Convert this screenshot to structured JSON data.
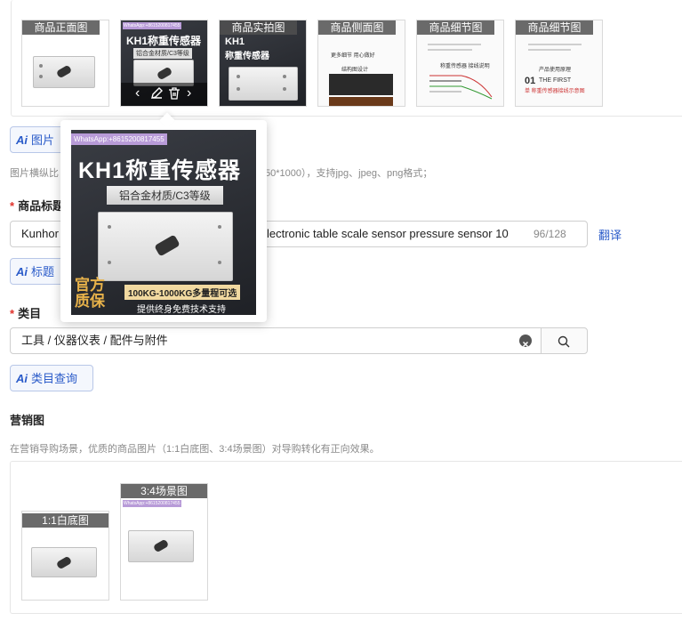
{
  "product_images": {
    "thumbnails": [
      {
        "label": "商品正面图"
      },
      {
        "label": "",
        "watermark": "WhatsApp:+8615200817455",
        "title": "KH1称重传感器",
        "subtitle": "铝合金材质/C3等级"
      },
      {
        "label": "商品实拍图",
        "title": "KH1",
        "subtitle": "称重传感器"
      },
      {
        "label": "商品侧面图",
        "text1": "更多细节 用心做好",
        "text2": "结构图设计"
      },
      {
        "label": "商品细节图",
        "text1": "称重传感器 接线说明"
      },
      {
        "label": "商品细节图",
        "text1": "产品使用原理",
        "text2": "THE FIRST",
        "text3": "单 称重传感器接线示意图",
        "num": "01"
      }
    ],
    "hover_controls": {
      "prev": "‹",
      "next": "›"
    },
    "popover": {
      "watermark": "WhatsApp:+8615200817455",
      "title": "KH1称重传感器",
      "subtitle": "铝合金材质/C3等级",
      "badge_line1": "官方",
      "badge_line2": "质保",
      "range": "100KG-1000KG多量程可选",
      "support": "提供终身免费技术支持"
    },
    "ai_button": "图片",
    "hint_left": "图片横纵比",
    "hint_right": "50*1000），支持jpg、jpeg、png格式；"
  },
  "title_field": {
    "label": "商品标题",
    "value_left": "Kunhor",
    "value_right": "lectronic table scale sensor pressure sensor 10",
    "counter": "96/128",
    "translate": "翻译",
    "ai_button": "标题"
  },
  "category_field": {
    "label": "类目",
    "value": "工具 / 仪器仪表 / 配件与附件",
    "ai_button": "类目查询"
  },
  "marketing": {
    "label": "营销图",
    "hint": "在营销导购场景，优质的商品图片（1:1白底图、3:4场景图）对导购转化有正向效果。",
    "images": [
      {
        "label": "1:1白底图"
      },
      {
        "label": "3:4场景图",
        "watermark": "WhatsApp:+8615200817455"
      }
    ]
  },
  "colors": {
    "accent": "#2a5bc9",
    "required": "#e0312a",
    "label_bg": "#555555"
  }
}
